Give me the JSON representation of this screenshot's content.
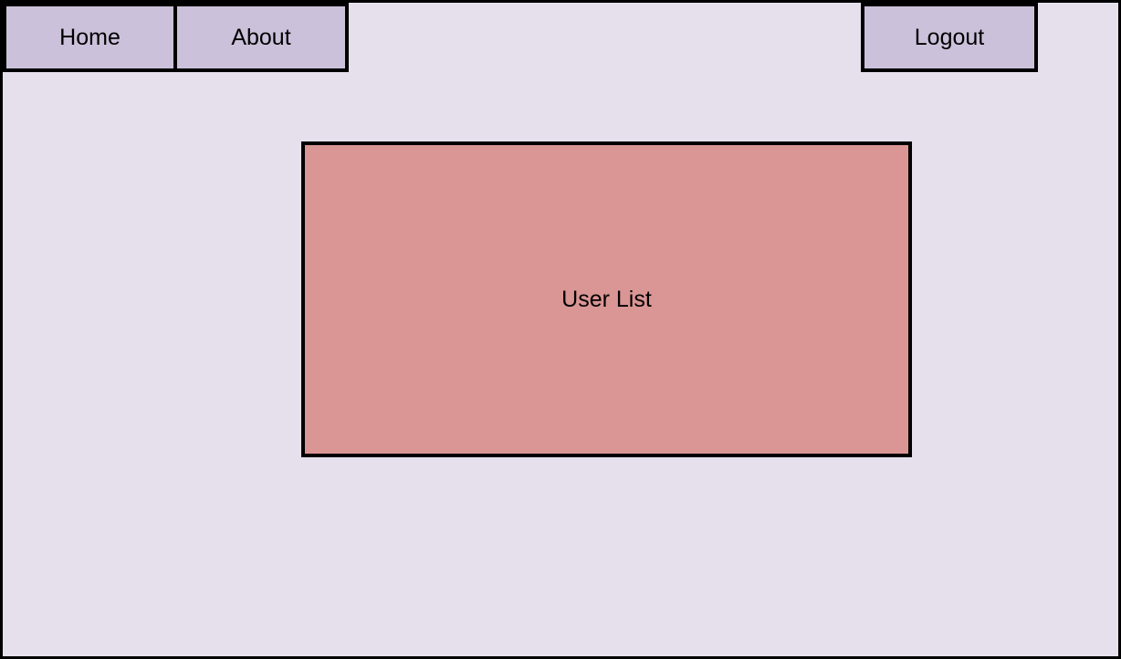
{
  "nav": {
    "home_label": "Home",
    "about_label": "About",
    "logout_label": "Logout"
  },
  "main": {
    "user_list_label": "User List"
  },
  "colors": {
    "background": "#e6e0ec",
    "nav_button": "#ccc1da",
    "user_list_panel": "#da9694",
    "border": "#000000"
  }
}
